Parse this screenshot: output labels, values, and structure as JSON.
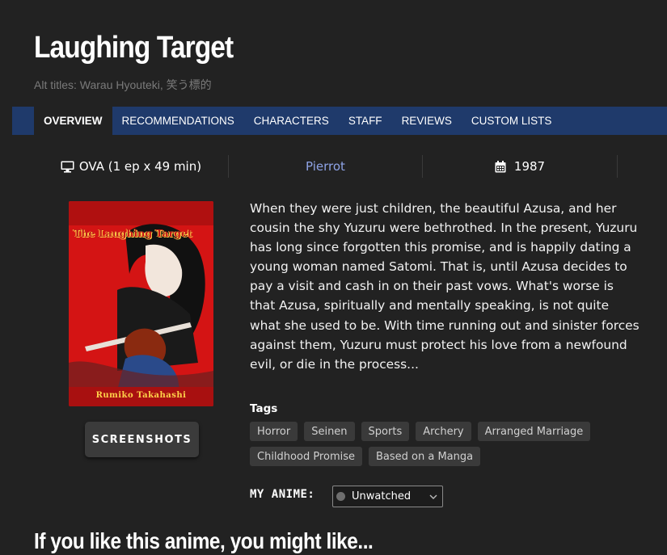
{
  "anime": {
    "title": "Laughing Target",
    "alt_titles": "Alt titles: Warau Hyouteki, 笑う標的"
  },
  "tabs": [
    {
      "label": "OVERVIEW",
      "active": true
    },
    {
      "label": "RECOMMENDATIONS"
    },
    {
      "label": "CHARACTERS"
    },
    {
      "label": "STAFF"
    },
    {
      "label": "REVIEWS"
    },
    {
      "label": "CUSTOM LISTS"
    }
  ],
  "info": {
    "format": "OVA (1 ep x 49 min)",
    "format_icon": "monitor-icon",
    "studio": "Pierrot",
    "year": "1987",
    "year_icon": "calendar-icon"
  },
  "cover": {
    "title_text": "The Laughing Target",
    "author_text": "Rumiko Takahashi"
  },
  "screenshots_label": "SCREENSHOTS",
  "synopsis": "When they were just children, the beautiful Azusa, and her cousin the shy Yuzuru were bethrothed. In the present, Yuzuru has long since forgotten this promise, and is happily dating a young woman named Satomi. That is, until Azusa decides to pay a visit and cash in on their past vows. What's worse is that Azusa, spiritually and mentally speaking, is not quite what she used to be. With time running out and sinister forces against them, Yuzuru must protect his love from a newfound evil, or die in the process...",
  "tags_label": "Tags",
  "tags": [
    "Horror",
    "Seinen",
    "Sports",
    "Archery",
    "Arranged Marriage",
    "Childhood Promise",
    "Based on a Manga"
  ],
  "my_anime": {
    "label": "MY ANIME:",
    "status": "Unwatched",
    "status_color": "#6e6e6e"
  },
  "recommendations_heading": "If you like this anime, you might like...",
  "colors": {
    "background": "#222222",
    "tab_bar": "#1f3a6b",
    "studio_link": "#8ea3e6"
  }
}
